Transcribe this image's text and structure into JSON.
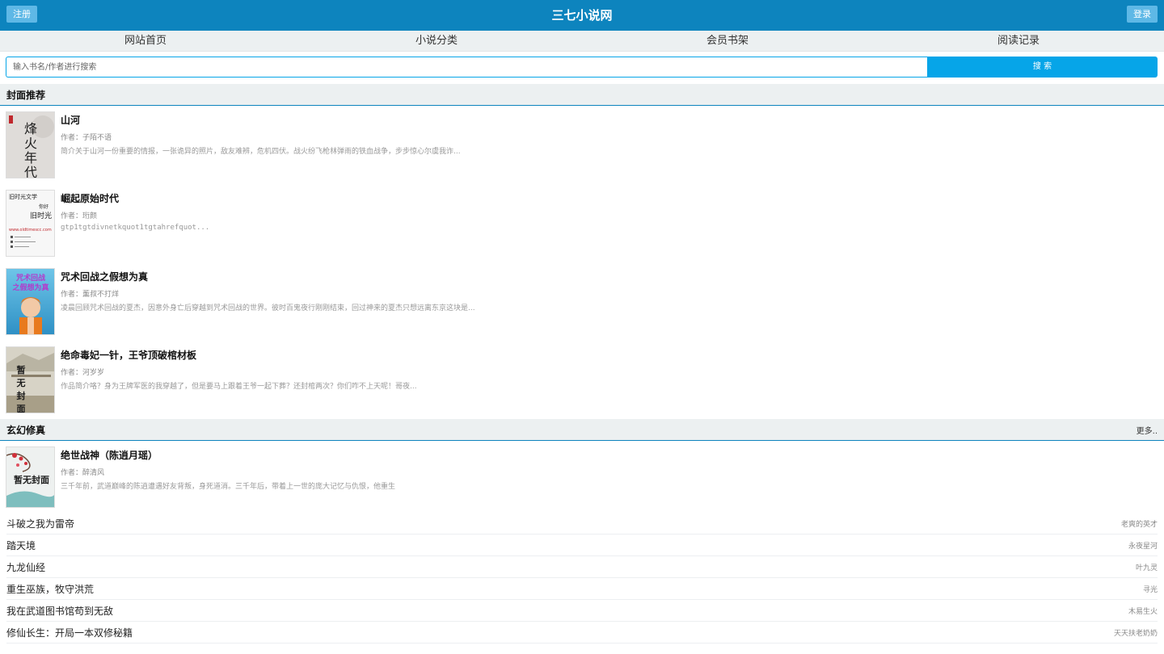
{
  "header": {
    "register_label": "注册",
    "site_title": "三七小说网",
    "login_label": "登录"
  },
  "nav": {
    "items": [
      "网站首页",
      "小说分类",
      "会员书架",
      "阅读记录"
    ]
  },
  "search": {
    "placeholder": "输入书名/作者进行搜索",
    "button_label": "搜 索"
  },
  "recommend": {
    "title": "封面推荐",
    "books": [
      {
        "name": "山河",
        "author": "作者：子陌不语",
        "intro": "简介关于山河一份重要的情报，一张诡异的照片，敌友难辨，危机四伏。战火纷飞枪林弹雨的铁血战争，步步惊心尔虞我诈...",
        "cover_text": "烽火年代"
      },
      {
        "name": "崛起原始时代",
        "author": "作者：珩颜",
        "intro": "gtp1tgtdivnetkquot1tgtahrefquot...",
        "cover_text": "旧时光文学"
      },
      {
        "name": "咒术回战之假想为真",
        "author": "作者：薰叔不打烊",
        "intro": "凌晨回顾咒术回战的夏杰，因意外身亡后穿越到咒术回战的世界。彼时百鬼夜行刚刚结束，回过神来的夏杰只想远离东京这块是...",
        "cover_text": "咒术回战之假想为真"
      },
      {
        "name": "绝命毒妃一针，王爷顶破棺材板",
        "author": "作者：河岁岁",
        "intro": "作品简介咯？身为王牌军医的我穿越了，但是要马上跟着王爷一起下葬？还封棺两次？你们咋不上天呢！哥夜...",
        "cover_text": "暂无封面"
      }
    ]
  },
  "xuanhuan": {
    "title": "玄幻修真",
    "more_label": "更多..",
    "featured": {
      "name": "绝世战神（陈逍月瑶）",
      "author": "作者：醉清风",
      "intro": "三千年前，武道巅峰的陈逍遭遇好友背叛，身死道消。三千年后，带着上一世的庞大记忆与仇恨，他重生",
      "cover_text": "暂无封面"
    },
    "list": [
      {
        "name": "斗破之我为雷帝",
        "author": "老爽的英才"
      },
      {
        "name": "踏天境",
        "author": "永夜星河"
      },
      {
        "name": "九龙仙经",
        "author": "叶九灵"
      },
      {
        "name": "重生巫族，牧守洪荒",
        "author": "寻光"
      },
      {
        "name": "我在武道图书馆苟到无敌",
        "author": "木易生火"
      },
      {
        "name": "修仙长生：开局一本双修秘籍",
        "author": "天天扶老奶奶"
      }
    ]
  }
}
